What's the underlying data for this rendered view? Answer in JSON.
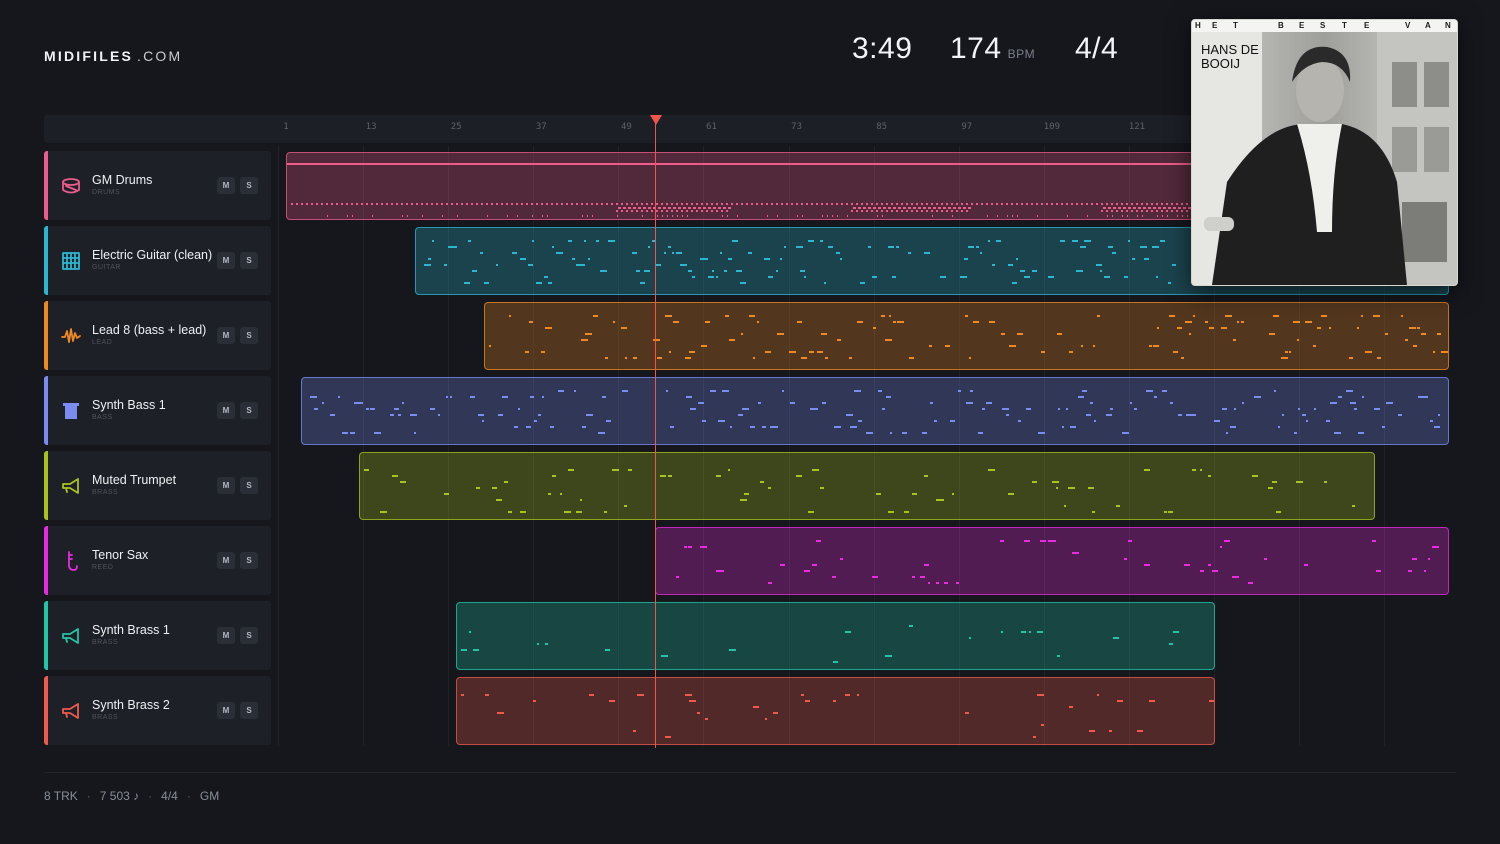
{
  "brand": {
    "name": "MIDIFILES",
    "tld": ".COM"
  },
  "stats": {
    "duration": "3:49",
    "bpm": "174",
    "bpm_unit": "BPM",
    "time_signature": "4/4"
  },
  "ruler_ticks": [
    "1",
    "13",
    "25",
    "37",
    "49",
    "61",
    "73",
    "85",
    "97",
    "109",
    "121"
  ],
  "tracks": [
    {
      "name": "GM Drums",
      "category": "DRUMS",
      "color": "#ec5b8a",
      "icon": "drum-icon",
      "mute": "M",
      "solo": "S"
    },
    {
      "name": "Electric Guitar (clean)",
      "category": "GUITAR",
      "color": "#2cb7d0",
      "icon": "guitar-icon",
      "mute": "M",
      "solo": "S"
    },
    {
      "name": "Lead 8 (bass + lead)",
      "category": "LEAD",
      "color": "#ef8a22",
      "icon": "waveform-icon",
      "mute": "M",
      "solo": "S"
    },
    {
      "name": "Synth Bass 1",
      "category": "BASS",
      "color": "#7a8cf0",
      "icon": "bass-icon",
      "mute": "M",
      "solo": "S"
    },
    {
      "name": "Muted Trumpet",
      "category": "BRASS",
      "color": "#a9c21e",
      "icon": "trumpet-icon",
      "mute": "M",
      "solo": "S"
    },
    {
      "name": "Tenor Sax",
      "category": "REED",
      "color": "#e92ae0",
      "icon": "sax-icon",
      "mute": "M",
      "solo": "S"
    },
    {
      "name": "Synth Brass 1",
      "category": "BRASS",
      "color": "#22c5a8",
      "icon": "trumpet-icon",
      "mute": "M",
      "solo": "S"
    },
    {
      "name": "Synth Brass 2",
      "category": "BRASS",
      "color": "#ef5a4c",
      "icon": "trumpet-icon",
      "mute": "M",
      "solo": "S"
    }
  ],
  "footer": {
    "tracks": "8 TRK",
    "notes": "7 503 ♪",
    "time_signature": "4/4",
    "standard": "GM"
  },
  "cover": {
    "top_text": "HET BESTE VAN",
    "artist_name": "HANS DE BOOIJ"
  }
}
